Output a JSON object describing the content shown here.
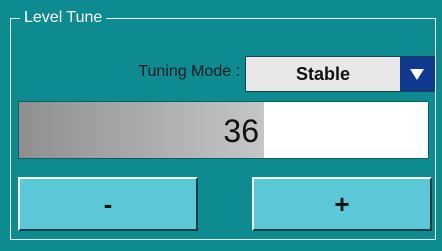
{
  "panel": {
    "title": "Level Tune"
  },
  "tuning": {
    "label": "Tuning Mode :",
    "value": "Stable"
  },
  "level": {
    "value": "36",
    "fraction": 0.6
  },
  "buttons": {
    "decrease_label": "-",
    "increase_label": "+"
  },
  "colors": {
    "background": "#0e8a91",
    "button": "#5cc8d7",
    "dropdown_arrow_bg": "#0f3a8f"
  },
  "icons": {
    "dropdown": "chevron-down-icon"
  }
}
